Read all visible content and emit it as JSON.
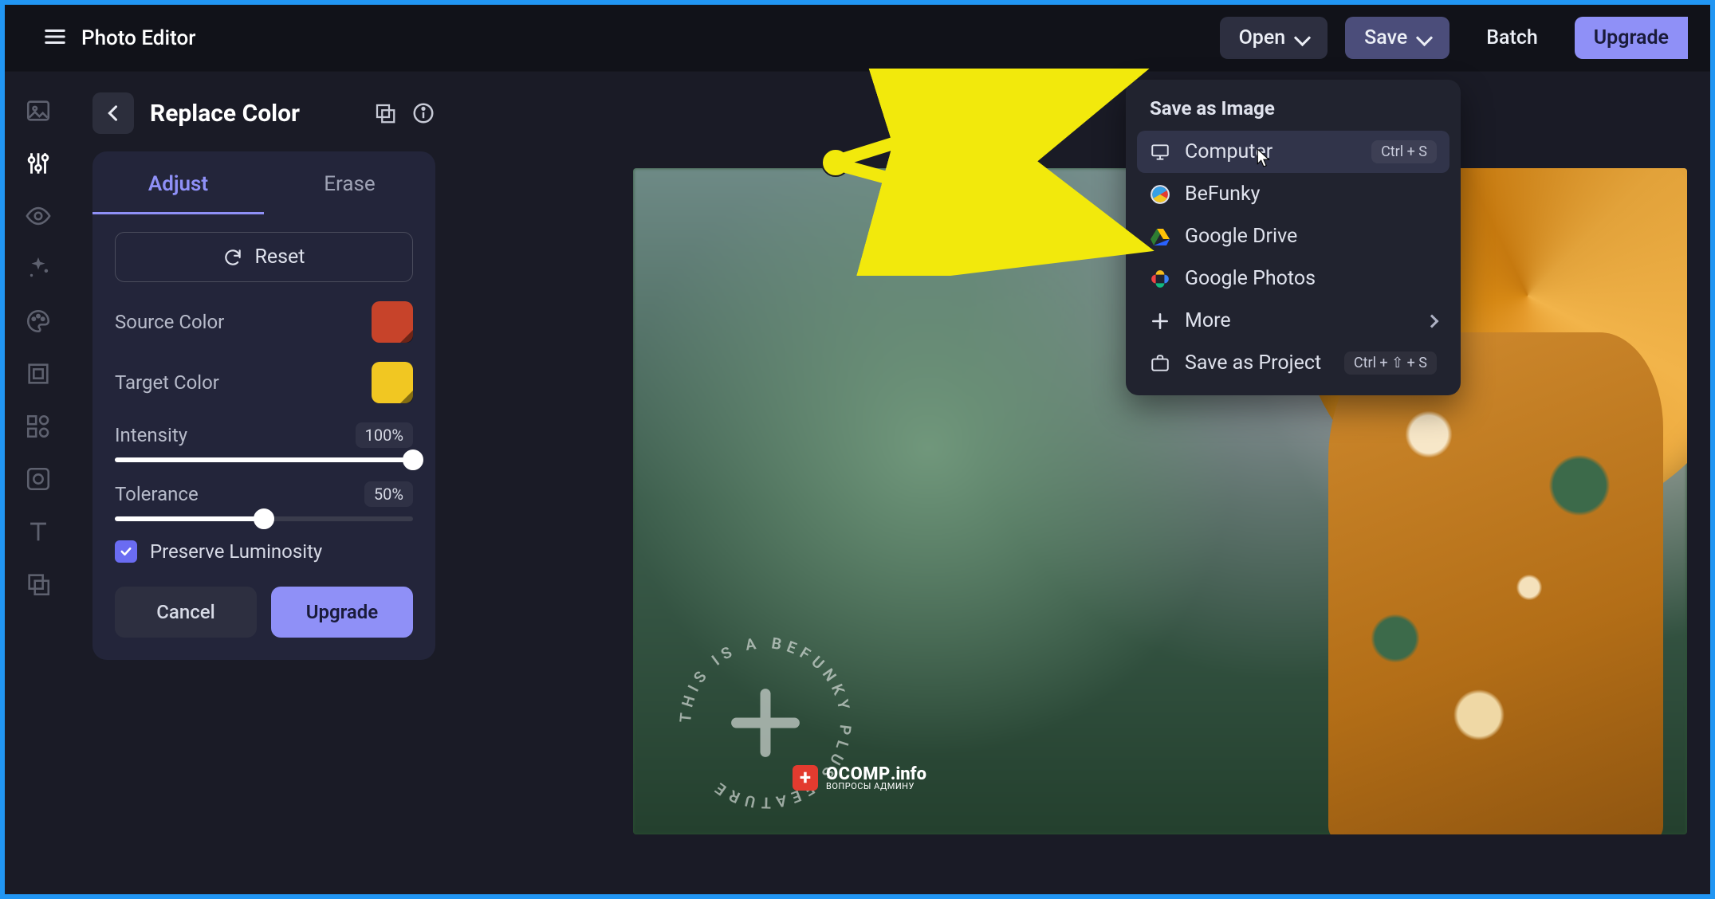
{
  "app": {
    "title": "Photo Editor"
  },
  "topbar": {
    "open": "Open",
    "save": "Save",
    "batch": "Batch",
    "upgrade": "Upgrade"
  },
  "panel": {
    "title": "Replace Color",
    "tab_adjust": "Adjust",
    "tab_erase": "Erase",
    "reset": "Reset",
    "source_color_label": "Source Color",
    "source_color_hex": "#c7432a",
    "target_color_label": "Target Color",
    "target_color_hex": "#f1c722",
    "intensity_label": "Intensity",
    "intensity_value": "100%",
    "intensity_pct": 100,
    "tolerance_label": "Tolerance",
    "tolerance_value": "50%",
    "tolerance_pct": 50,
    "preserve_label": "Preserve Luminosity",
    "preserve_checked": true,
    "cancel": "Cancel",
    "upgrade": "Upgrade"
  },
  "save_menu": {
    "title": "Save as Image",
    "items": {
      "computer": {
        "label": "Computer",
        "shortcut": "Ctrl + S"
      },
      "befunky": {
        "label": "BeFunky"
      },
      "gdrive": {
        "label": "Google Drive"
      },
      "gphotos": {
        "label": "Google Photos"
      },
      "more": {
        "label": "More"
      },
      "project": {
        "label": "Save as Project",
        "shortcut": "Ctrl + ⇧ + S"
      }
    }
  },
  "watermark": {
    "ring": "THIS IS A BEFUNKY PLUS FEATURE",
    "site1": "OCOMP",
    "site2": ".info",
    "sub": "ВОПРОСЫ АДМИНУ"
  }
}
